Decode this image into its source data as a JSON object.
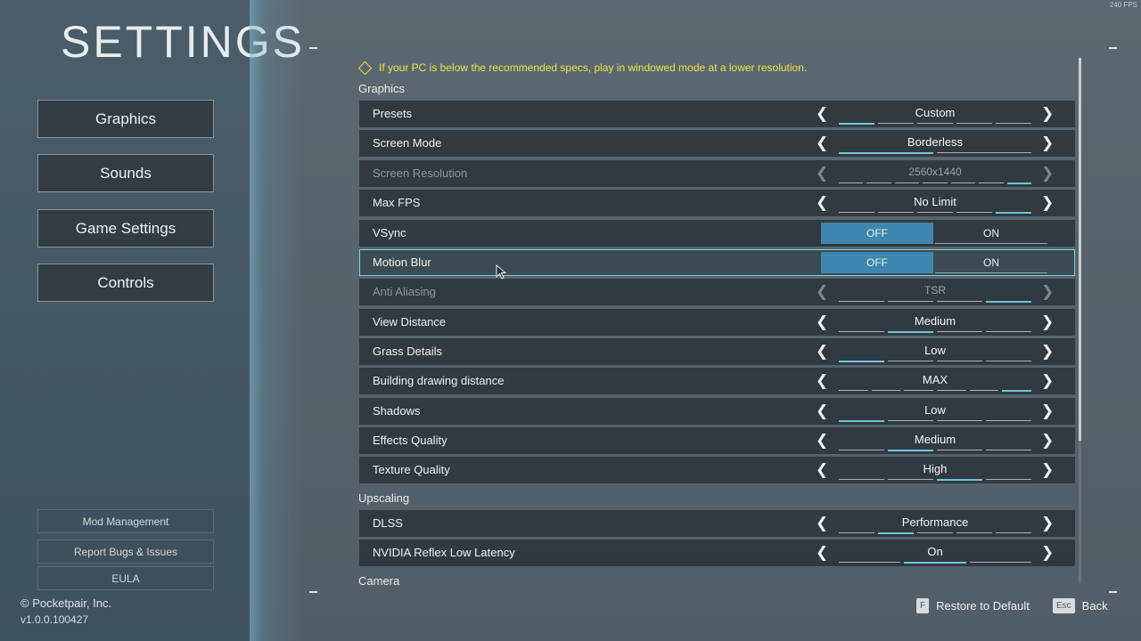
{
  "fps_counter": "240 FPS",
  "left_panel": {
    "title": "SETTINGS",
    "nav": [
      {
        "label": "Graphics"
      },
      {
        "label": "Sounds"
      },
      {
        "label": "Game Settings"
      },
      {
        "label": "Controls"
      }
    ],
    "links": [
      {
        "label": "Mod Management"
      },
      {
        "label": "Report Bugs & Issues"
      },
      {
        "label": "EULA"
      }
    ],
    "copyright": "© Pocketpair, Inc.",
    "version": "v1.0.0.100427"
  },
  "warning": {
    "icon": "warning-icon",
    "text": "If your PC is below the recommended specs, play in windowed mode at a lower resolution."
  },
  "sections": {
    "graphics": "Graphics",
    "upscaling": "Upscaling",
    "camera": "Camera"
  },
  "rows": [
    {
      "label": "Presets",
      "value": "Custom",
      "segments": 5,
      "active": 0
    },
    {
      "label": "Screen Mode",
      "value": "Borderless",
      "segments": 2,
      "active": 0
    },
    {
      "label": "Screen Resolution",
      "value": "2560x1440",
      "segments": 7,
      "active": 6
    },
    {
      "label": "Max FPS",
      "value": "No Limit",
      "segments": 5,
      "active": 4
    },
    {
      "label": "VSync",
      "toggle_off": "OFF",
      "toggle_on": "ON",
      "state": "OFF"
    },
    {
      "label": "Motion Blur",
      "toggle_off": "OFF",
      "toggle_on": "ON",
      "state": "OFF"
    },
    {
      "label": "Anti Aliasing",
      "value": "TSR",
      "segments": 4,
      "active": 3
    },
    {
      "label": "View Distance",
      "value": "Medium",
      "segments": 4,
      "active": 1
    },
    {
      "label": "Grass Details",
      "value": "Low",
      "segments": 4,
      "active": 0
    },
    {
      "label": "Building drawing distance",
      "value": "MAX",
      "segments": 6,
      "active": 5
    },
    {
      "label": "Shadows",
      "value": "Low",
      "segments": 4,
      "active": 0
    },
    {
      "label": "Effects Quality",
      "value": "Medium",
      "segments": 4,
      "active": 1
    },
    {
      "label": "Texture Quality",
      "value": "High",
      "segments": 4,
      "active": 2
    },
    {
      "label": "DLSS",
      "value": "Performance",
      "segments": 5,
      "active": 1
    },
    {
      "label": "NVIDIA Reflex Low Latency",
      "value": "On",
      "segments": 3,
      "active": 1
    }
  ],
  "footer": {
    "restore_key": "F",
    "restore_label": "Restore to Default",
    "back_key": "Esc",
    "back_label": "Back"
  }
}
